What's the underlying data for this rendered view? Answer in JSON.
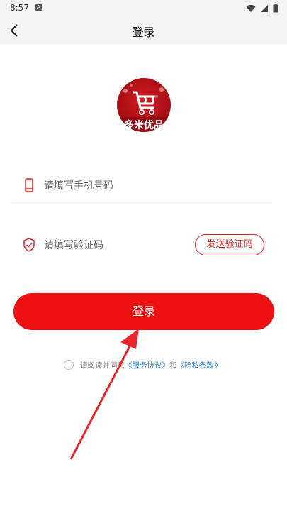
{
  "status_bar": {
    "time": "8:57",
    "a_badge": "A"
  },
  "app_bar": {
    "title": "登录"
  },
  "logo": {
    "text": "多米优品"
  },
  "phone": {
    "placeholder": "请填写手机号码"
  },
  "code": {
    "placeholder": "请填写验证码",
    "send_label": "发送验证码"
  },
  "login": {
    "label": "登录"
  },
  "agreement": {
    "prefix": "请阅读并同意",
    "service_link": "《服务协议》",
    "and": "和",
    "privacy_link": "《隐私条款》"
  },
  "colors": {
    "primary": "#ee1111",
    "link": "#2a7ad9"
  }
}
